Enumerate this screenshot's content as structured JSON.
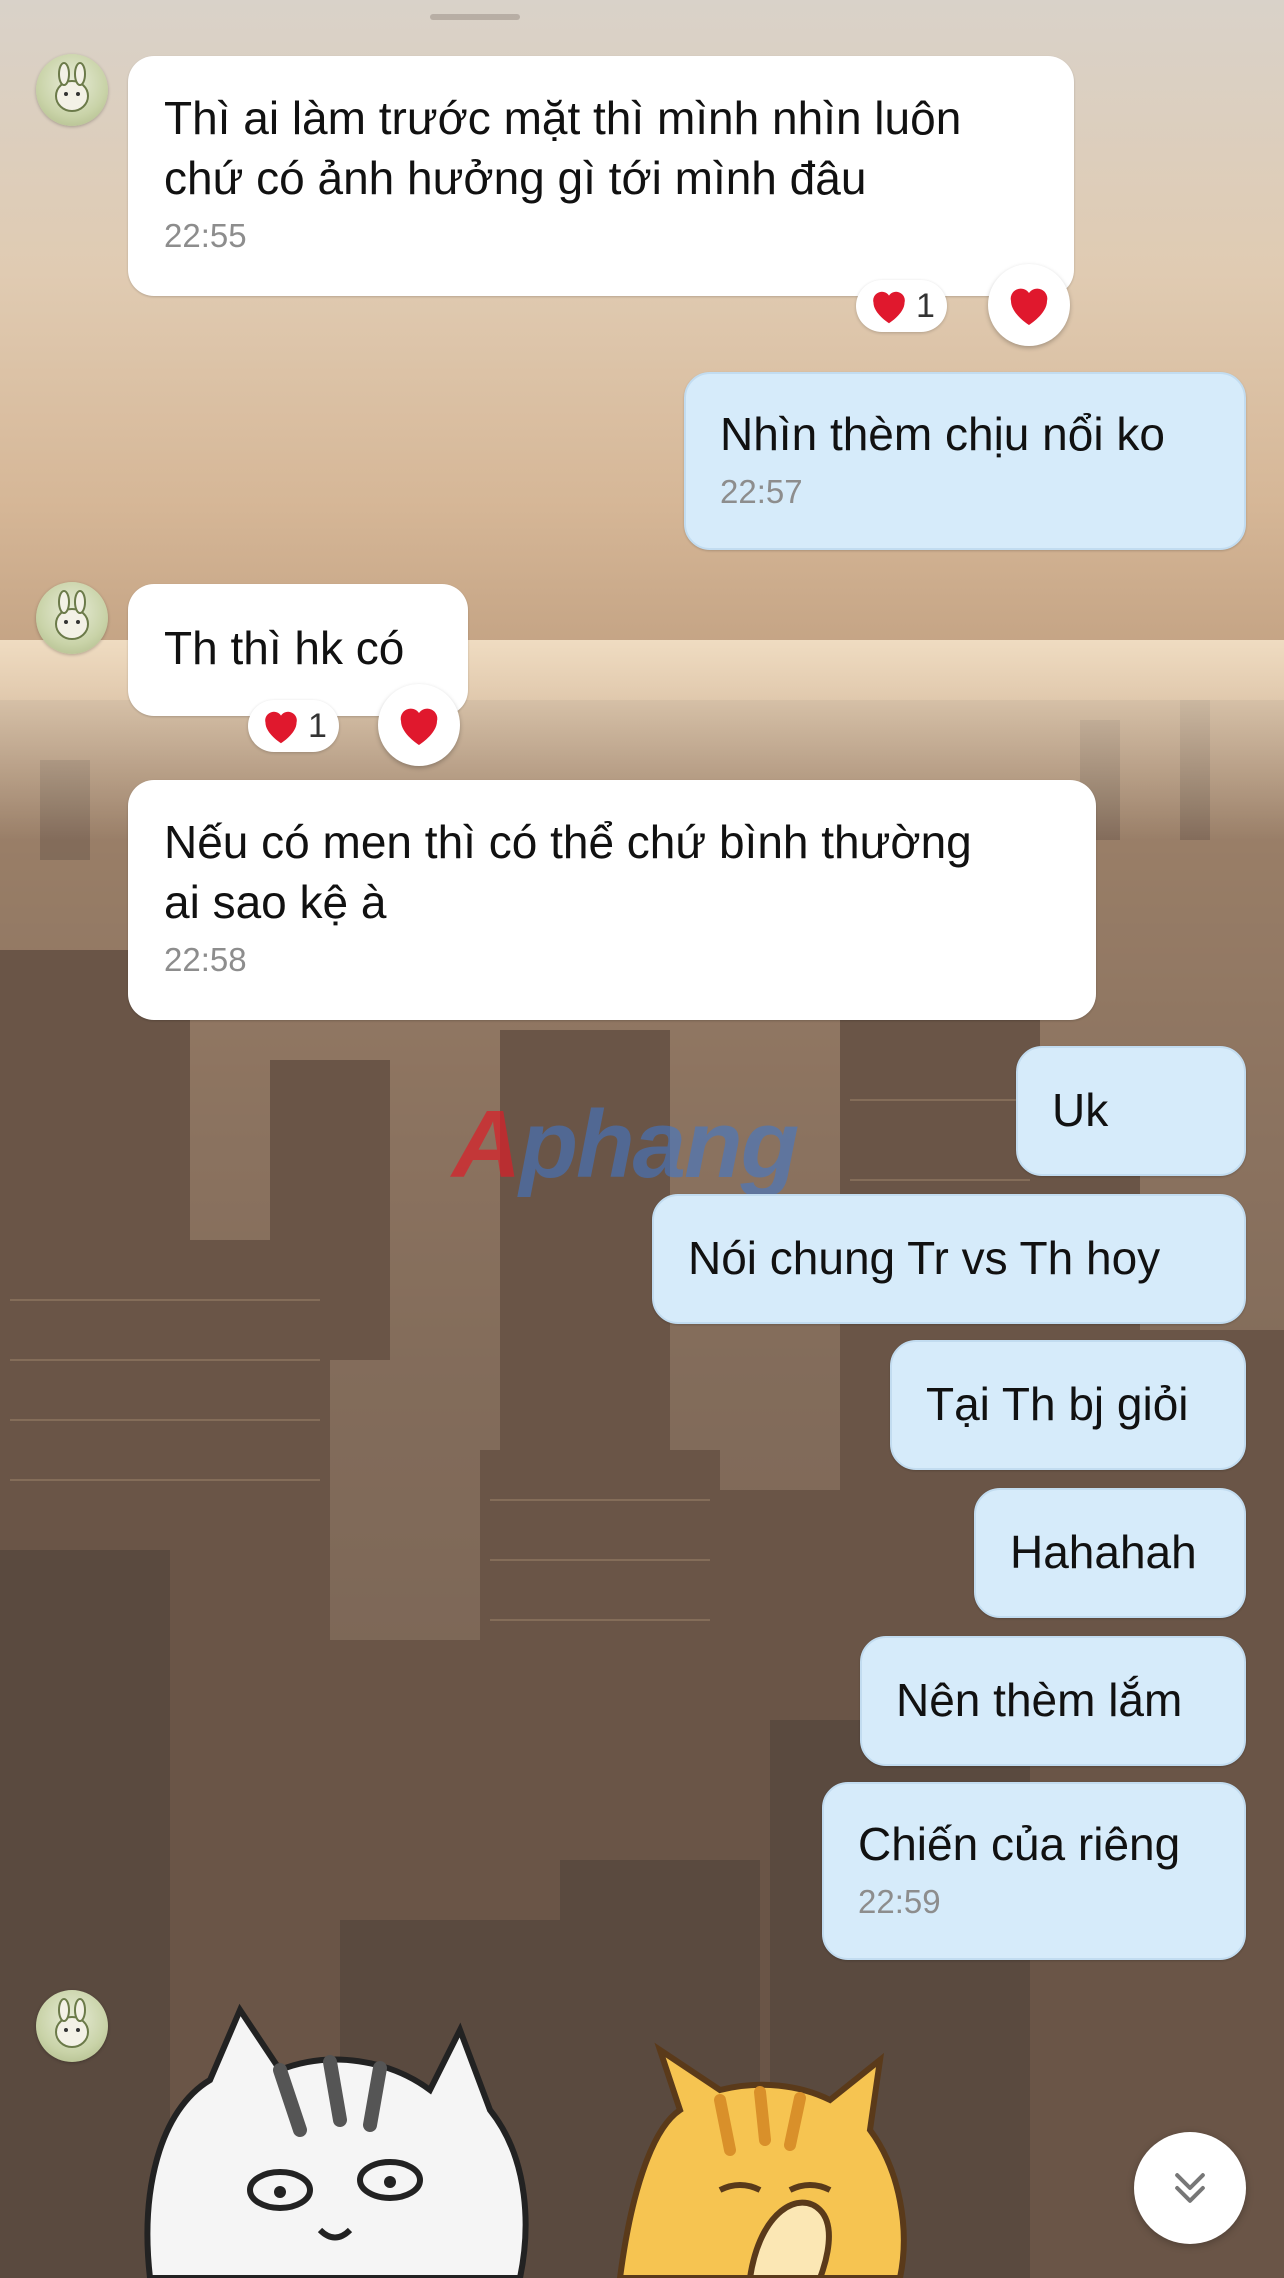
{
  "colors": {
    "incoming_bubble": "#ffffff",
    "outgoing_bubble": "#d6ebfa",
    "timestamp": "#8d8d8d",
    "heart": "#e0182d"
  },
  "messages": [
    {
      "direction": "in",
      "text": "Thì ai làm trước mặt thì mình nhìn luôn\nchứ có ảnh hưởng gì tới mình đâu",
      "time": "22:55",
      "reaction": {
        "icon": "heart-icon",
        "count": "1"
      }
    },
    {
      "direction": "out",
      "text": "Nhìn thèm chịu nổi ko",
      "time": "22:57"
    },
    {
      "direction": "in",
      "text": "Th thì hk có",
      "reaction": {
        "icon": "heart-icon",
        "count": "1"
      }
    },
    {
      "direction": "in",
      "text": "Nếu có men thì có thể chứ bình thường\nai sao kệ à",
      "time": "22:58"
    },
    {
      "direction": "out",
      "text": "Uk"
    },
    {
      "direction": "out",
      "text": "Nói chung Tr vs Th hoy"
    },
    {
      "direction": "out",
      "text": "Tại Th bj giỏi"
    },
    {
      "direction": "out",
      "text": "Hahahah"
    },
    {
      "direction": "out",
      "text": "Nên thèm lắm"
    },
    {
      "direction": "out",
      "text": "Chiến của riêng",
      "time": "22:59"
    }
  ],
  "watermark": {
    "text_first": "A",
    "text_rest": "phang"
  },
  "stickers": [
    "gray-cat-sticker",
    "orange-cat-sticker"
  ],
  "scroll_button": {
    "icon": "double-chevron-down-icon"
  }
}
